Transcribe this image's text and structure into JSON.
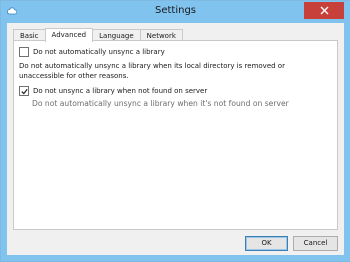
{
  "window": {
    "title": "Settings"
  },
  "tabs": [
    {
      "label": "Basic"
    },
    {
      "label": "Advanced"
    },
    {
      "label": "Language"
    },
    {
      "label": "Network"
    }
  ],
  "active_tab": "Advanced",
  "advanced": {
    "option1": {
      "label": "Do not automatically unsync a library",
      "checked": false,
      "description": "Do not automatically unsync a library when its local directory is removed or unaccessible for other reasons."
    },
    "option2": {
      "label": "Do not unsync a library when not found on server",
      "checked": true,
      "description": "Do not automatically unsync a library when it's not found on server"
    }
  },
  "buttons": {
    "ok": "OK",
    "cancel": "Cancel"
  },
  "colors": {
    "titlebar": "#7fc3ee",
    "close": "#c7413a"
  },
  "icons": {
    "app": "cloud-icon",
    "close": "close-icon",
    "check": "checkmark-icon"
  }
}
